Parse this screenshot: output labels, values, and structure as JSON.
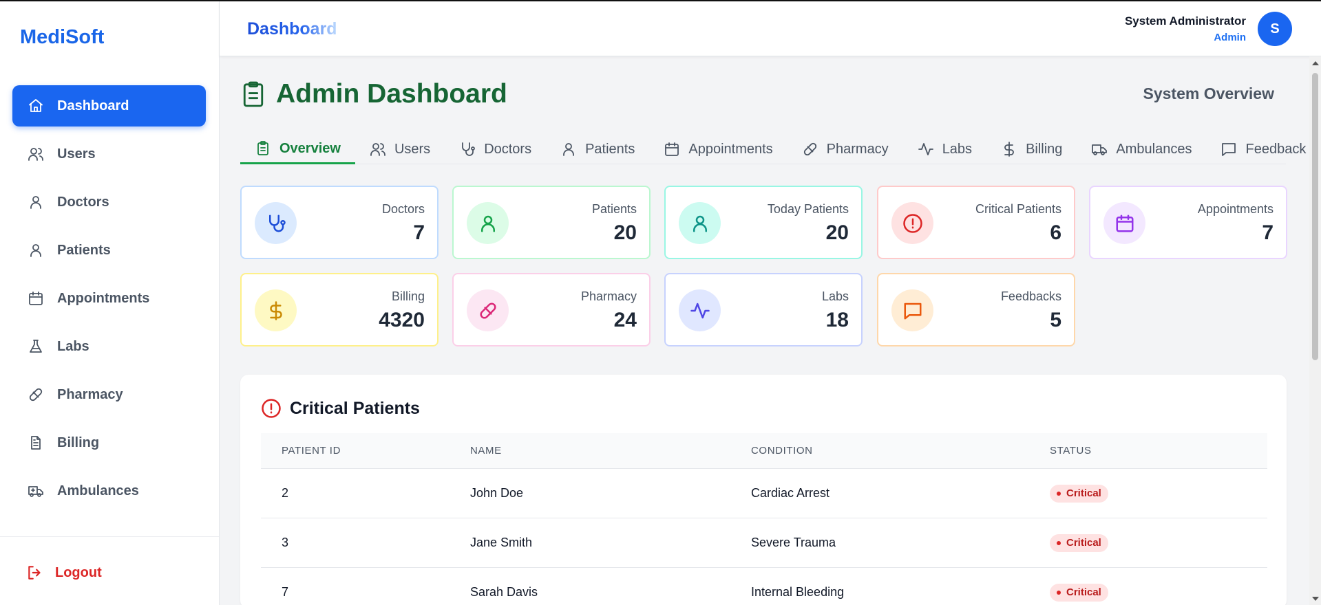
{
  "brand": "MediSoft",
  "header": {
    "title": "Dashboard",
    "user_name": "System Administrator",
    "user_role": "Admin",
    "avatar_letter": "S"
  },
  "sidebar": {
    "items": [
      {
        "label": "Dashboard",
        "icon": "home-icon"
      },
      {
        "label": "Users",
        "icon": "users-icon"
      },
      {
        "label": "Doctors",
        "icon": "user-icon"
      },
      {
        "label": "Patients",
        "icon": "user-icon"
      },
      {
        "label": "Appointments",
        "icon": "calendar-icon"
      },
      {
        "label": "Labs",
        "icon": "flask-icon"
      },
      {
        "label": "Pharmacy",
        "icon": "pill-icon"
      },
      {
        "label": "Billing",
        "icon": "file-text-icon"
      },
      {
        "label": "Ambulances",
        "icon": "ambulance-icon"
      }
    ],
    "logout": "Logout"
  },
  "main": {
    "title": "Admin Dashboard",
    "subtitle": "System Overview",
    "tabs": [
      {
        "label": "Overview",
        "icon": "clipboard-icon"
      },
      {
        "label": "Users",
        "icon": "users-icon"
      },
      {
        "label": "Doctors",
        "icon": "stethoscope-icon"
      },
      {
        "label": "Patients",
        "icon": "user-icon"
      },
      {
        "label": "Appointments",
        "icon": "calendar-icon"
      },
      {
        "label": "Pharmacy",
        "icon": "pill-icon"
      },
      {
        "label": "Labs",
        "icon": "activity-icon"
      },
      {
        "label": "Billing",
        "icon": "dollar-icon"
      },
      {
        "label": "Ambulances",
        "icon": "truck-icon"
      },
      {
        "label": "Feedback",
        "icon": "message-icon"
      }
    ],
    "stats": [
      {
        "label": "Doctors",
        "value": "7",
        "icon": "stethoscope-icon",
        "color": "#1d4ed8",
        "bg": "#dbeafe",
        "border": "#bfdbfe"
      },
      {
        "label": "Patients",
        "value": "20",
        "icon": "user-icon",
        "color": "#16a34a",
        "bg": "#dcfce7",
        "border": "#bbf7d0"
      },
      {
        "label": "Today Patients",
        "value": "20",
        "icon": "user-icon",
        "color": "#0d9488",
        "bg": "#ccfbf1",
        "border": "#99f6e4"
      },
      {
        "label": "Critical Patients",
        "value": "6",
        "icon": "alert-circle-icon",
        "color": "#dc2626",
        "bg": "#fee2e2",
        "border": "#fecaca"
      },
      {
        "label": "Appointments",
        "value": "7",
        "icon": "calendar-icon",
        "color": "#9333ea",
        "bg": "#f3e8ff",
        "border": "#e9d5ff"
      },
      {
        "label": "Billing",
        "value": "4320",
        "icon": "dollar-icon",
        "color": "#ca8a04",
        "bg": "#fef9c3",
        "border": "#fef08a"
      },
      {
        "label": "Pharmacy",
        "value": "24",
        "icon": "pill-icon",
        "color": "#db2777",
        "bg": "#fce7f3",
        "border": "#fbcfe8"
      },
      {
        "label": "Labs",
        "value": "18",
        "icon": "activity-icon",
        "color": "#4f46e5",
        "bg": "#e0e7ff",
        "border": "#c7d2fe"
      },
      {
        "label": "Feedbacks",
        "value": "5",
        "icon": "message-icon",
        "color": "#ea580c",
        "bg": "#ffedd5",
        "border": "#fed7aa"
      }
    ],
    "critical": {
      "title": "Critical Patients",
      "columns": [
        "Patient ID",
        "Name",
        "Condition",
        "Status"
      ],
      "rows": [
        {
          "id": "2",
          "name": "John Doe",
          "condition": "Cardiac Arrest",
          "status": "Critical"
        },
        {
          "id": "3",
          "name": "Jane Smith",
          "condition": "Severe Trauma",
          "status": "Critical"
        },
        {
          "id": "7",
          "name": "Sarah Davis",
          "condition": "Internal Bleeding",
          "status": "Critical"
        }
      ]
    }
  }
}
